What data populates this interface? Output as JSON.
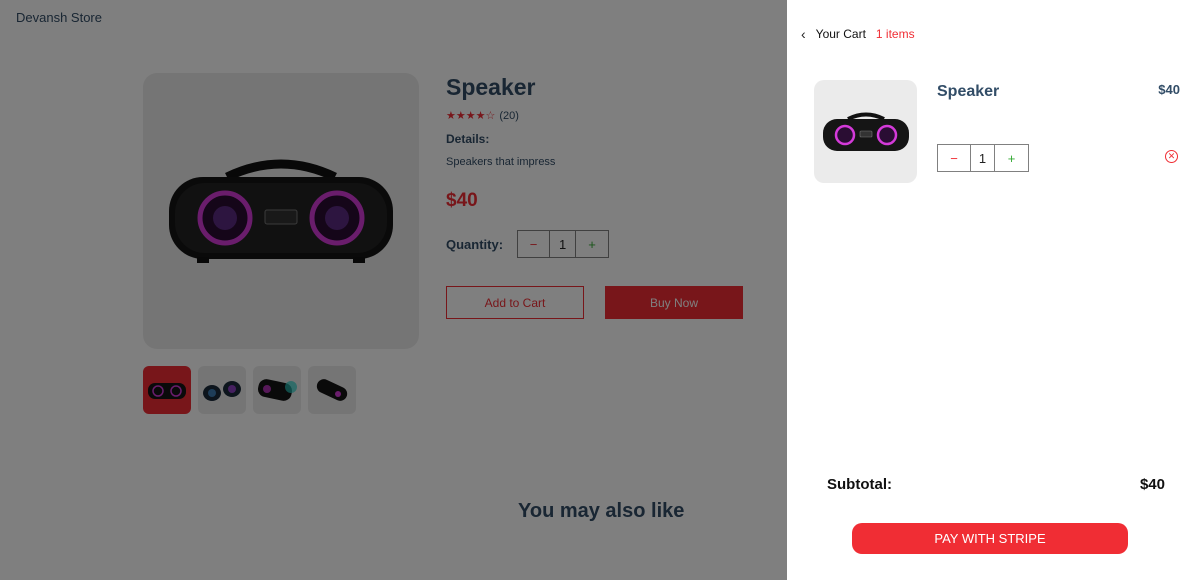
{
  "store": {
    "brand": "Devansh Store",
    "product": {
      "title": "Speaker",
      "stars": "★★★★☆",
      "review_count": "(20)",
      "details_label": "Details:",
      "details": "Speakers that impress",
      "price": "$40",
      "quantity_label": "Quantity:",
      "qty_minus": "−",
      "qty_value": "1",
      "qty_plus": "+"
    },
    "thumbnails": [
      "speaker-front",
      "speaker-angled",
      "speaker-lit",
      "speaker-side"
    ],
    "add_to_cart": "Add to Cart",
    "buy_now": "Buy Now",
    "may_also_like": "You may also like"
  },
  "cart": {
    "back_icon": "chevron-left-icon",
    "heading": "Your Cart",
    "item_count": "1 items",
    "items": [
      {
        "name": "Speaker",
        "price": "$40",
        "qty_minus": "−",
        "qty_value": "1",
        "qty_plus": "+",
        "remove_glyph": "✕"
      }
    ],
    "subtotal_label": "Subtotal:",
    "subtotal_value": "$40",
    "pay_button": "PAY WITH STRIPE"
  },
  "colors": {
    "accent": "#f02d34",
    "text": "#324d67",
    "plus": "#31a831",
    "panel_bg": "#ffffff",
    "image_bg": "#ebebeb"
  }
}
